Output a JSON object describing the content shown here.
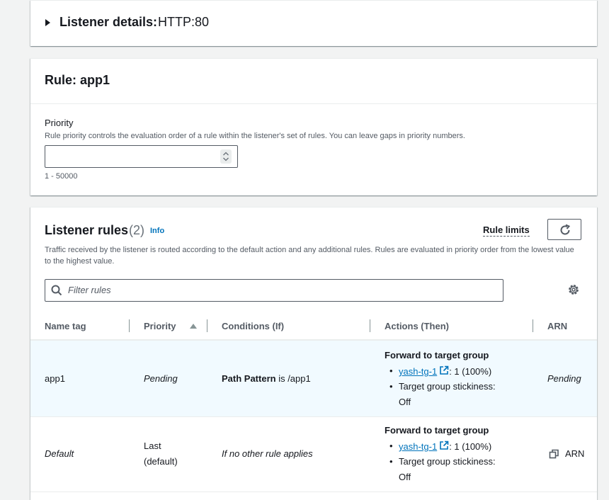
{
  "listener": {
    "title": "Listener details:",
    "value": "HTTP:80"
  },
  "rule": {
    "title": "Rule: app1",
    "priority_label": "Priority",
    "priority_desc": "Rule priority controls the evaluation order of a rule within the listener's set of rules. You can leave gaps in priority numbers.",
    "priority_value": "",
    "priority_hint": "1 - 50000"
  },
  "rules": {
    "title": "Listener rules",
    "count": "(2)",
    "info": "Info",
    "rule_limits": "Rule limits",
    "desc": "Traffic received by the listener is routed according to the default action and any additional rules. Rules are evaluated in priority order from the lowest value to the highest value.",
    "filter_placeholder": "Filter rules",
    "columns": [
      "Name tag",
      "Priority",
      "Conditions (If)",
      "Actions (Then)",
      "ARN"
    ],
    "rows": [
      {
        "name": "app1",
        "priority": "Pending",
        "cond_bold": "Path Pattern",
        "cond_rest": " is /app1",
        "action_title": "Forward to target group",
        "tg_name": "yash-tg-1",
        "tg_weight": ": 1 (100%)",
        "stickiness": "Target group stickiness:",
        "stickiness_value": "Off",
        "arn": "Pending"
      },
      {
        "name": "Default",
        "priority_line1": "Last",
        "priority_line2": "(default)",
        "cond": "If no other rule applies",
        "action_title": "Forward to target group",
        "tg_name": "yash-tg-1",
        "tg_weight": ": 1 (100%)",
        "stickiness": "Target group stickiness:",
        "stickiness_value": "Off",
        "arn": "ARN"
      }
    ]
  },
  "colors": {
    "link": "#0073bb",
    "selected_row": "#f1faff",
    "border": "#545b64"
  }
}
